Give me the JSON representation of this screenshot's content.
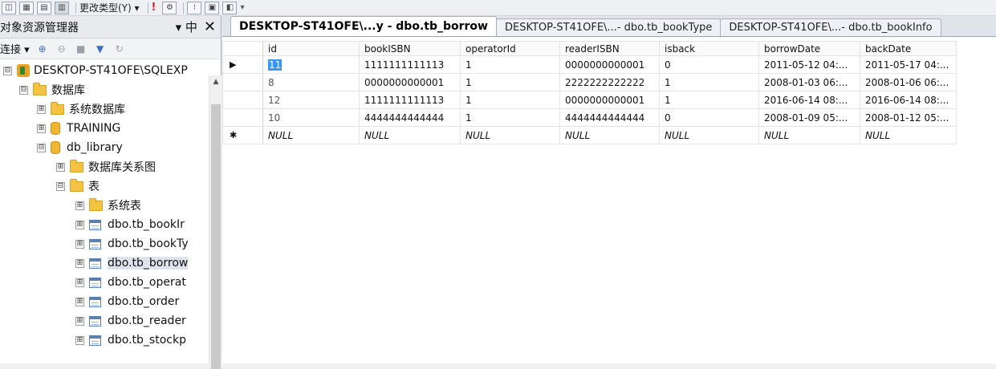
{
  "toolbar": {
    "change_type_label": "更改类型(Y) ▾",
    "exec_glyph": "!",
    "more_glyph": "▾"
  },
  "explorer": {
    "title": "对象资源管理器",
    "pin_glyph": "▾ 中",
    "close_glyph": "✕",
    "connect_label": "连接 ▾",
    "tree": [
      {
        "label": "DESKTOP-ST41OFE\\SQLEXP",
        "expander": "⊟"
      },
      {
        "label": "数据库",
        "expander": "⊟"
      },
      {
        "label": "系统数据库",
        "expander": "⊞"
      },
      {
        "label": "TRAINING",
        "expander": "⊞"
      },
      {
        "label": "db_library",
        "expander": "⊟"
      },
      {
        "label": "数据库关系图",
        "expander": "⊞"
      },
      {
        "label": "表",
        "expander": "⊟"
      },
      {
        "label": "系统表",
        "expander": "⊞"
      },
      {
        "label": "dbo.tb_bookIr",
        "expander": "⊞"
      },
      {
        "label": "dbo.tb_bookTy",
        "expander": "⊞"
      },
      {
        "label": "dbo.tb_borrow",
        "expander": "⊞"
      },
      {
        "label": "dbo.tb_operat",
        "expander": "⊞"
      },
      {
        "label": "dbo.tb_order",
        "expander": "⊞"
      },
      {
        "label": "dbo.tb_reader",
        "expander": "⊞"
      },
      {
        "label": "dbo.tb_stockp",
        "expander": "⊞"
      }
    ]
  },
  "tabs": [
    {
      "label": "DESKTOP-ST41OFE\\...y - dbo.tb_borrow"
    },
    {
      "label": "DESKTOP-ST41OFE\\...- dbo.tb_bookType"
    },
    {
      "label": "DESKTOP-ST41OFE\\...- dbo.tb_bookInfo"
    }
  ],
  "grid": {
    "columns": [
      "id",
      "bookISBN",
      "operatorId",
      "readerISBN",
      "isback",
      "borrowDate",
      "backDate"
    ],
    "rows": [
      {
        "indicator": "▶",
        "cells": [
          "11",
          "1111111111113",
          "1",
          "0000000000001",
          "0",
          "2011-05-12 04:...",
          "2011-05-17 04:..."
        ]
      },
      {
        "indicator": "",
        "cells": [
          "8",
          "0000000000001",
          "1",
          "2222222222222",
          "1",
          "2008-01-03 06:...",
          "2008-01-06 06:..."
        ]
      },
      {
        "indicator": "",
        "cells": [
          "12",
          "1111111111113",
          "1",
          "0000000000001",
          "1",
          "2016-06-14 08:...",
          "2016-06-14 08:..."
        ]
      },
      {
        "indicator": "",
        "cells": [
          "10",
          "4444444444444",
          "1",
          "4444444444444",
          "0",
          "2008-01-09 05:...",
          "2008-01-12 05:..."
        ]
      }
    ],
    "new_row": {
      "indicator": "✱",
      "cells": [
        "NULL",
        "NULL",
        "NULL",
        "NULL",
        "NULL",
        "NULL",
        "NULL"
      ]
    }
  }
}
